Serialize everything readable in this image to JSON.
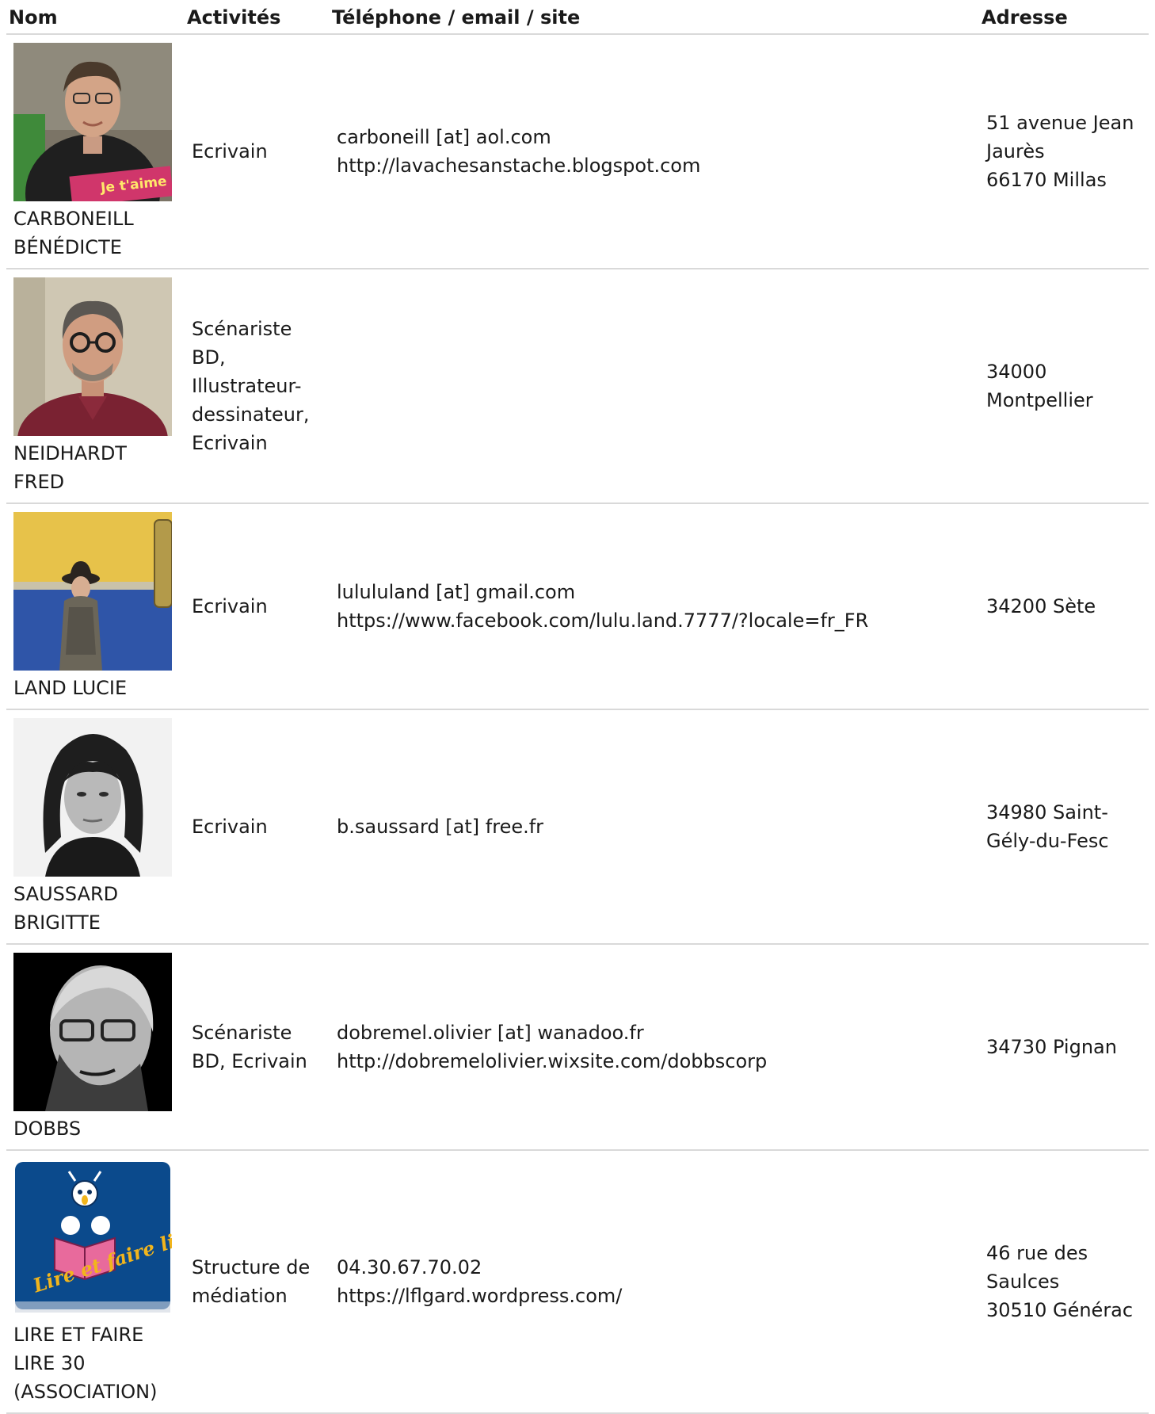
{
  "headers": {
    "nom": "Nom",
    "activites": "Activités",
    "contact": "Téléphone / email / site",
    "adresse": "Adresse"
  },
  "rows": [
    {
      "name": [
        "CARBONEILL",
        "BÉNÉDICTE"
      ],
      "activity": [
        "Ecrivain"
      ],
      "contact": [
        "carboneill [at] aol.com",
        "http://lavachesanstache.blogspot.com"
      ],
      "address": [
        "51 avenue Jean",
        "Jaurès",
        "66170 Millas"
      ],
      "photo": {
        "icon": "person-photo",
        "book_text": "Je t'aime"
      }
    },
    {
      "name": [
        "NEIDHARDT",
        "FRED"
      ],
      "activity": [
        "Scénariste",
        "BD,",
        "Illustrateur-",
        "dessinateur,",
        "Ecrivain"
      ],
      "contact": [],
      "address": [
        "34000",
        "Montpellier"
      ],
      "photo": {
        "icon": "person-photo"
      }
    },
    {
      "name": [
        "LAND LUCIE"
      ],
      "activity": [
        "Ecrivain"
      ],
      "contact": [
        "lulululand [at] gmail.com",
        "https://www.facebook.com/lulu.land.7777/?locale=fr_FR"
      ],
      "address": [
        "34200 Sète"
      ],
      "photo": {
        "icon": "person-photo"
      }
    },
    {
      "name": [
        "SAUSSARD",
        "BRIGITTE"
      ],
      "activity": [
        "Ecrivain"
      ],
      "contact": [
        "b.saussard [at] free.fr"
      ],
      "address": [
        "34980 Saint-",
        "Gély-du-Fesc"
      ],
      "photo": {
        "icon": "person-photo"
      }
    },
    {
      "name": [
        "DOBBS"
      ],
      "activity": [
        "Scénariste",
        "BD, Ecrivain"
      ],
      "contact": [
        "dobremel.olivier [at] wanadoo.fr",
        "http://dobremelolivier.wixsite.com/dobbscorp"
      ],
      "address": [
        "34730 Pignan"
      ],
      "photo": {
        "icon": "person-photo"
      }
    },
    {
      "name": [
        "LIRE ET FAIRE",
        "LIRE 30",
        "(ASSOCIATION)"
      ],
      "activity": [
        "Structure de",
        "médiation"
      ],
      "contact": [
        "04.30.67.70.02",
        "https://lflgard.wordpress.com/"
      ],
      "address": [
        "46 rue des",
        "Saulces",
        "30510 Générac"
      ],
      "photo": {
        "icon": "lire-et-faire-lire-logo",
        "logo_text": "Lire et faire lire"
      }
    }
  ]
}
